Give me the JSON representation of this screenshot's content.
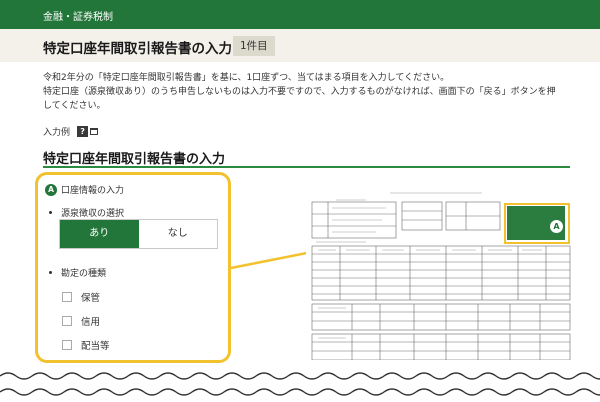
{
  "header": {
    "breadcrumb": "金融・証券税制"
  },
  "page": {
    "title": "特定口座年間取引報告書の入力",
    "count_badge": "1件目"
  },
  "intro": {
    "line1": "令和2年分の「特定口座年間取引報告書」を基に、1口座ずつ、当てはまる項目を入力してください。",
    "line2": "特定口座（源泉徴収あり）のうち申告しないものは入力不要ですので、入力するものがなければ、画面下の「戻る」ボタンを押してください。"
  },
  "example": {
    "label": "入力例",
    "help_icon": "question-icon",
    "window_icon": "new-window-icon"
  },
  "section": {
    "title": "特定口座年間取引報告書の入力"
  },
  "account_info": {
    "badge": "A",
    "label": "口座情報の入力",
    "withholding": {
      "label": "源泉徴収の選択",
      "options": [
        "あり",
        "なし"
      ],
      "selected": "あり"
    },
    "type": {
      "label": "勘定の種類",
      "options": [
        {
          "label": "保管",
          "checked": false
        },
        {
          "label": "信用",
          "checked": false
        },
        {
          "label": "配当等",
          "checked": false
        }
      ]
    }
  },
  "form_preview": {
    "badge": "A"
  },
  "colors": {
    "brand_green": "#23763a",
    "highlight_yellow": "#f2c12e",
    "title_band": "#f3f1ea"
  }
}
